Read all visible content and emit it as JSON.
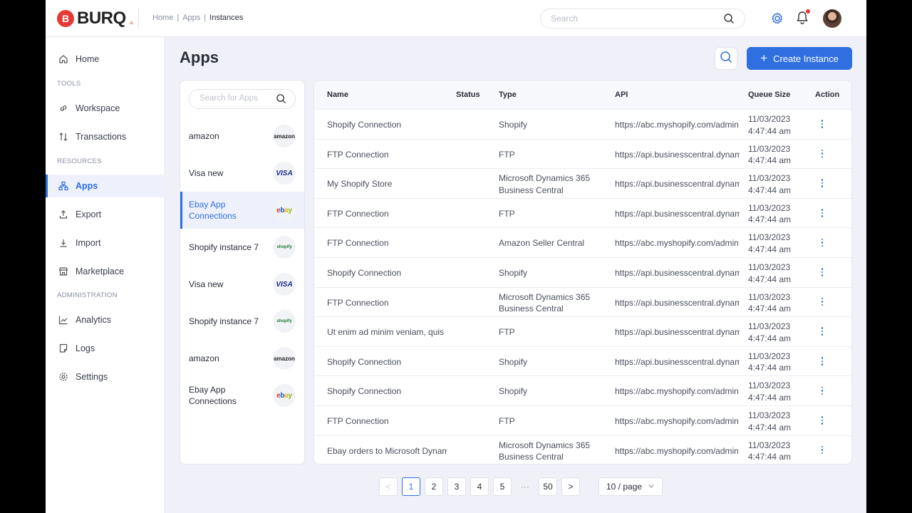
{
  "brand": {
    "name": "BURQ",
    "suffix": ".io",
    "mark": "B"
  },
  "breadcrumb": [
    "Home",
    "Apps",
    "Instances"
  ],
  "breadcrumb_sep": "|",
  "top_search": {
    "placeholder": "Search"
  },
  "sidebar": {
    "home": "Home",
    "tools_header": "TOOLS",
    "workspace": "Workspace",
    "transactions": "Transactions",
    "resources_header": "RESOURCES",
    "apps": "Apps",
    "export": "Export",
    "import": "Import",
    "marketplace": "Marketplace",
    "admin_header": "ADMINISTRATION",
    "analytics": "Analytics",
    "logs": "Logs",
    "settings": "Settings"
  },
  "page": {
    "title": "Apps",
    "create_label": "Create Instance",
    "create_plus": "+"
  },
  "apps_search": {
    "placeholder": "Search for Apps"
  },
  "apps": [
    {
      "name": "amazon",
      "logo": "amazon"
    },
    {
      "name": "Visa new",
      "logo": "VISA"
    },
    {
      "name": "Ebay App Connections",
      "logo": "ebay",
      "active": true
    },
    {
      "name": "Shopify instance 7",
      "logo": "shopify"
    },
    {
      "name": "Visa new",
      "logo": "VISA"
    },
    {
      "name": "Shopify instance 7",
      "logo": "shopify"
    },
    {
      "name": "amazon",
      "logo": "amazon"
    },
    {
      "name": "Ebay App Connections",
      "logo": "ebay"
    }
  ],
  "table": {
    "headers": {
      "name": "Name",
      "status": "Status",
      "type": "Type",
      "api": "API",
      "queue": "Queue Size",
      "action": "Action"
    },
    "rows": [
      {
        "name": "Shopify Connection",
        "on": true,
        "type": "Shopify",
        "api": "https://abc.myshopify.com/admin",
        "date": "11/03/2023",
        "time": "4:47:44 am"
      },
      {
        "name": "FTP Connection",
        "on": true,
        "type": "FTP",
        "api": "https://api.businesscentral.dynamics.com",
        "date": "11/03/2023",
        "time": "4:47:44 am"
      },
      {
        "name": "My Shopify Store",
        "on": true,
        "type": "Microsoft Dynamics 365 Business Central",
        "api": "https://api.businesscentral.dynamics.com",
        "date": "11/03/2023",
        "time": "4:47:44 am"
      },
      {
        "name": "FTP Connection",
        "on": false,
        "type": "FTP",
        "api": "https://api.businesscentral.dynamics.com",
        "date": "11/03/2023",
        "time": "4:47:44 am"
      },
      {
        "name": "FTP Connection",
        "on": false,
        "type": "Amazon Seller Central",
        "api": "https://abc.myshopify.com/admin",
        "date": "11/03/2023",
        "time": "4:47:44 am"
      },
      {
        "name": "Shopify Connection",
        "on": true,
        "type": "Shopify",
        "api": "https://api.businesscentral.dynamics.com",
        "date": "11/03/2023",
        "time": "4:47:44 am"
      },
      {
        "name": "FTP Connection",
        "on": true,
        "type": "Microsoft Dynamics 365 Business Central",
        "api": "https://api.businesscentral.dynamics.com",
        "date": "11/03/2023",
        "time": "4:47:44 am"
      },
      {
        "name": "Ut enim ad minim veniam, quis",
        "on": true,
        "type": "FTP",
        "api": "https://api.businesscentral.dynamics.com",
        "date": "11/03/2023",
        "time": "4:47:44 am"
      },
      {
        "name": "Shopify Connection",
        "on": false,
        "type": "Shopify",
        "api": "https://api.businesscentral.dynamics.com",
        "date": "11/03/2023",
        "time": "4:47:44 am"
      },
      {
        "name": "Shopify Connection",
        "on": true,
        "type": "Shopify",
        "api": "https://abc.myshopify.com/admin",
        "date": "11/03/2023",
        "time": "4:47:44 am"
      },
      {
        "name": "FTP Connection",
        "on": false,
        "type": "FTP",
        "api": "https://abc.myshopify.com/admin",
        "date": "11/03/2023",
        "time": "4:47:44 am"
      },
      {
        "name": "Ebay orders to Microsoft Dynamics",
        "on": true,
        "type": "Microsoft Dynamics 365 Business Central",
        "api": "https://abc.myshopify.com/admin",
        "date": "11/03/2023",
        "time": "4:47:44 am"
      }
    ]
  },
  "pagination": {
    "prev": "<",
    "next": ">",
    "ellipsis": "···",
    "pages": [
      "1",
      "2",
      "3",
      "4",
      "5"
    ],
    "last": "50",
    "current": "1",
    "page_size": "10 / page"
  },
  "colors": {
    "accent": "#2f6fe0",
    "toggle_on": "#2e8b2e",
    "brand_red": "#e53935"
  },
  "icons": [
    "search-icon",
    "gear-icon",
    "bell-icon",
    "home-icon",
    "link-icon",
    "transactions-icon",
    "apps-icon",
    "export-icon",
    "import-icon",
    "marketplace-icon",
    "analytics-icon",
    "logs-icon",
    "settings-icon",
    "plus-icon",
    "more-vertical-icon",
    "chevron-down-icon"
  ]
}
